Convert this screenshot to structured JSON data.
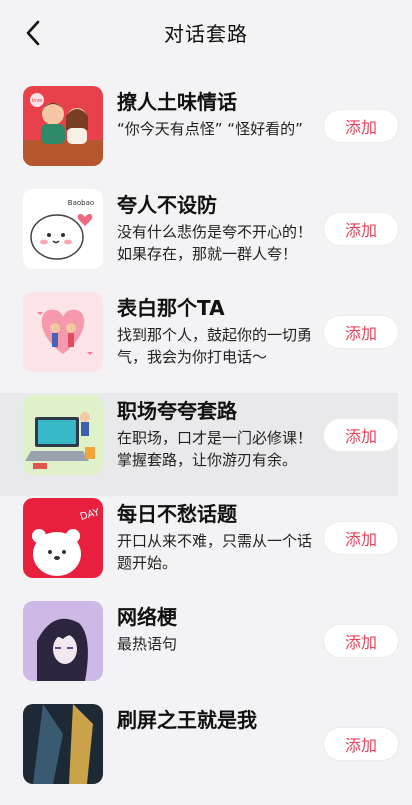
{
  "header": {
    "title": "对话套路",
    "back_icon": "chevron-left-icon"
  },
  "items": [
    {
      "name": "撩人土味情话",
      "desc": "“你今天有点怪” “怪好看的”",
      "add": "添加",
      "thumb_label": "love"
    },
    {
      "name": "夸人不设防",
      "desc": "没有什么悲伤是夸不开心的！如果存在，那就一群人夸！",
      "add": "添加",
      "thumb_label": "Baobao"
    },
    {
      "name": "表白那个TA",
      "desc": "找到那个人，鼓起你的一切勇气，我会为你打电话～",
      "add": "添加"
    },
    {
      "name": "职场夸夸套路",
      "desc": "在职场，口才是一门必修课！掌握套路，让你游刃有余。",
      "add": "添加"
    },
    {
      "name": "每日不愁话题",
      "desc": "开口从来不难，只需从一个话题开始。",
      "add": "添加",
      "thumb_label": "DAY"
    },
    {
      "name": "网络梗",
      "desc": "最热语句",
      "add": "添加"
    },
    {
      "name": "刷屏之王就是我",
      "desc": "",
      "add": "添加"
    }
  ],
  "colors": {
    "accent": "#e9445a",
    "background": "#f3f3f6"
  }
}
